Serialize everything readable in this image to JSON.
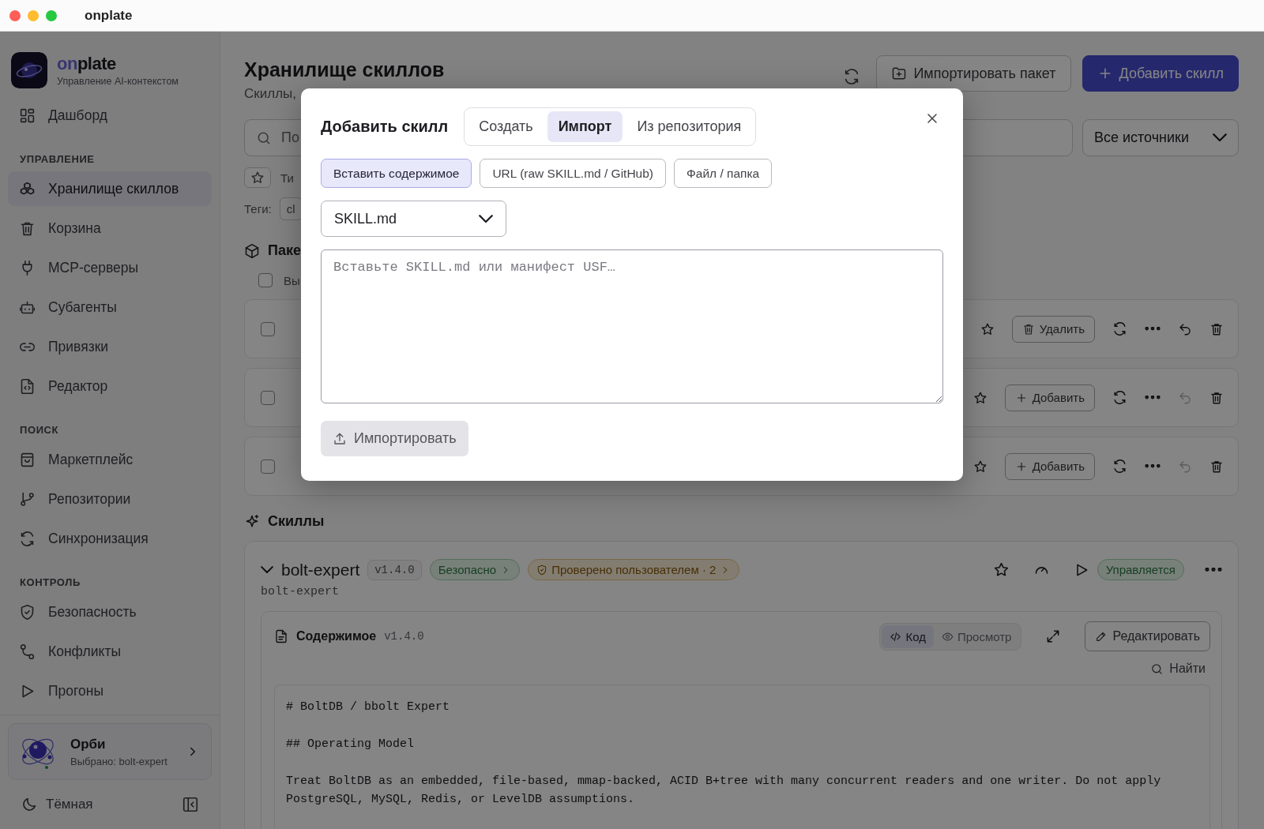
{
  "window": {
    "title": "onplate"
  },
  "sidebar": {
    "brand": {
      "accent": "on",
      "name": "plate",
      "subtitle": "Управление AI-контекстом"
    },
    "groups": [
      {
        "items": [
          {
            "label": "Дашборд",
            "selected": false
          }
        ]
      },
      {
        "heading": "УПРАВЛЕНИЕ",
        "items": [
          {
            "label": "Хранилище скиллов",
            "selected": true
          },
          {
            "label": "Корзина",
            "selected": false
          },
          {
            "label": "MCP-серверы",
            "selected": false
          },
          {
            "label": "Субагенты",
            "selected": false
          },
          {
            "label": "Привязки",
            "selected": false
          },
          {
            "label": "Редактор",
            "selected": false
          }
        ]
      },
      {
        "heading": "ПОИСК",
        "items": [
          {
            "label": "Маркетплейс",
            "selected": false
          },
          {
            "label": "Репозитории",
            "selected": false
          },
          {
            "label": "Синхронизация",
            "selected": false
          }
        ]
      },
      {
        "heading": "КОНТРОЛЬ",
        "items": [
          {
            "label": "Безопасность",
            "selected": false
          },
          {
            "label": "Конфликты",
            "selected": false
          },
          {
            "label": "Прогоны",
            "selected": false
          }
        ]
      }
    ],
    "assistant": {
      "name": "Орби",
      "detail": "Выбрано: bolt-expert"
    },
    "theme": {
      "label": "Тёмная"
    }
  },
  "header": {
    "title": "Хранилище скиллов",
    "subtitle": "Скиллы,",
    "actions": [
      {
        "label": "Импортировать пакет",
        "kind": "secondary"
      },
      {
        "label": "Добавить скилл",
        "kind": "primary"
      }
    ]
  },
  "filters": {
    "search": {
      "placeholder": "По"
    },
    "source": {
      "value": "Все источники"
    },
    "type_label": "Ти",
    "tags_label": "Теги:",
    "tags": [
      "cl"
    ]
  },
  "packages": {
    "title": "Паке",
    "select_all": {
      "label": "Вы",
      "checked": false
    },
    "rows": [
      {
        "checked": false,
        "action": {
          "label": "Удалить",
          "kind": "remove"
        },
        "undo_disabled": false
      },
      {
        "checked": false,
        "action": {
          "label": "Добавить",
          "kind": "add"
        },
        "undo_disabled": true
      },
      {
        "checked": false,
        "action": {
          "label": "Добавить",
          "kind": "add"
        },
        "undo_disabled": true
      }
    ]
  },
  "skills": {
    "title": "Скиллы",
    "items": [
      {
        "name": "bolt-expert",
        "version": "v1.4.0",
        "expanded": true,
        "safety": "Безопасно",
        "verified": "Проверено пользователем · 2",
        "status": "Управляется",
        "slug": "bolt-expert",
        "content": {
          "title": "Содержимое",
          "version": "v1.4.0",
          "views": [
            {
              "label": "Код",
              "selected": true
            },
            {
              "label": "Просмотр",
              "selected": false
            }
          ],
          "edit": "Редактировать",
          "find": "Найти",
          "paragraphs": [
            [
              "# BoltDB / bbolt Expert"
            ],
            [
              "## Operating Model"
            ],
            [
              "Treat BoltDB as an embedded, file-based, mmap-backed, ACID B+tree with many concurrent readers and one writer. Do not apply",
              "PostgreSQL, MySQL, Redis, or LevelDB assumptions."
            ]
          ]
        }
      }
    ]
  },
  "dialog": {
    "title": "Добавить скилл",
    "tabs": [
      {
        "label": "Создать",
        "selected": false
      },
      {
        "label": "Импорт",
        "selected": true
      },
      {
        "label": "Из репозитория",
        "selected": false
      }
    ],
    "sources": [
      {
        "label": "Вставить содержимое",
        "selected": true
      },
      {
        "label": "URL (raw SKILL.md / GitHub)",
        "selected": false
      },
      {
        "label": "Файл / папка",
        "selected": false
      }
    ],
    "format": {
      "value": "SKILL.md"
    },
    "content": {
      "placeholder": "Вставьте SKILL.md или манифест USF…"
    },
    "submit": {
      "label": "Импортировать",
      "disabled": true
    }
  }
}
